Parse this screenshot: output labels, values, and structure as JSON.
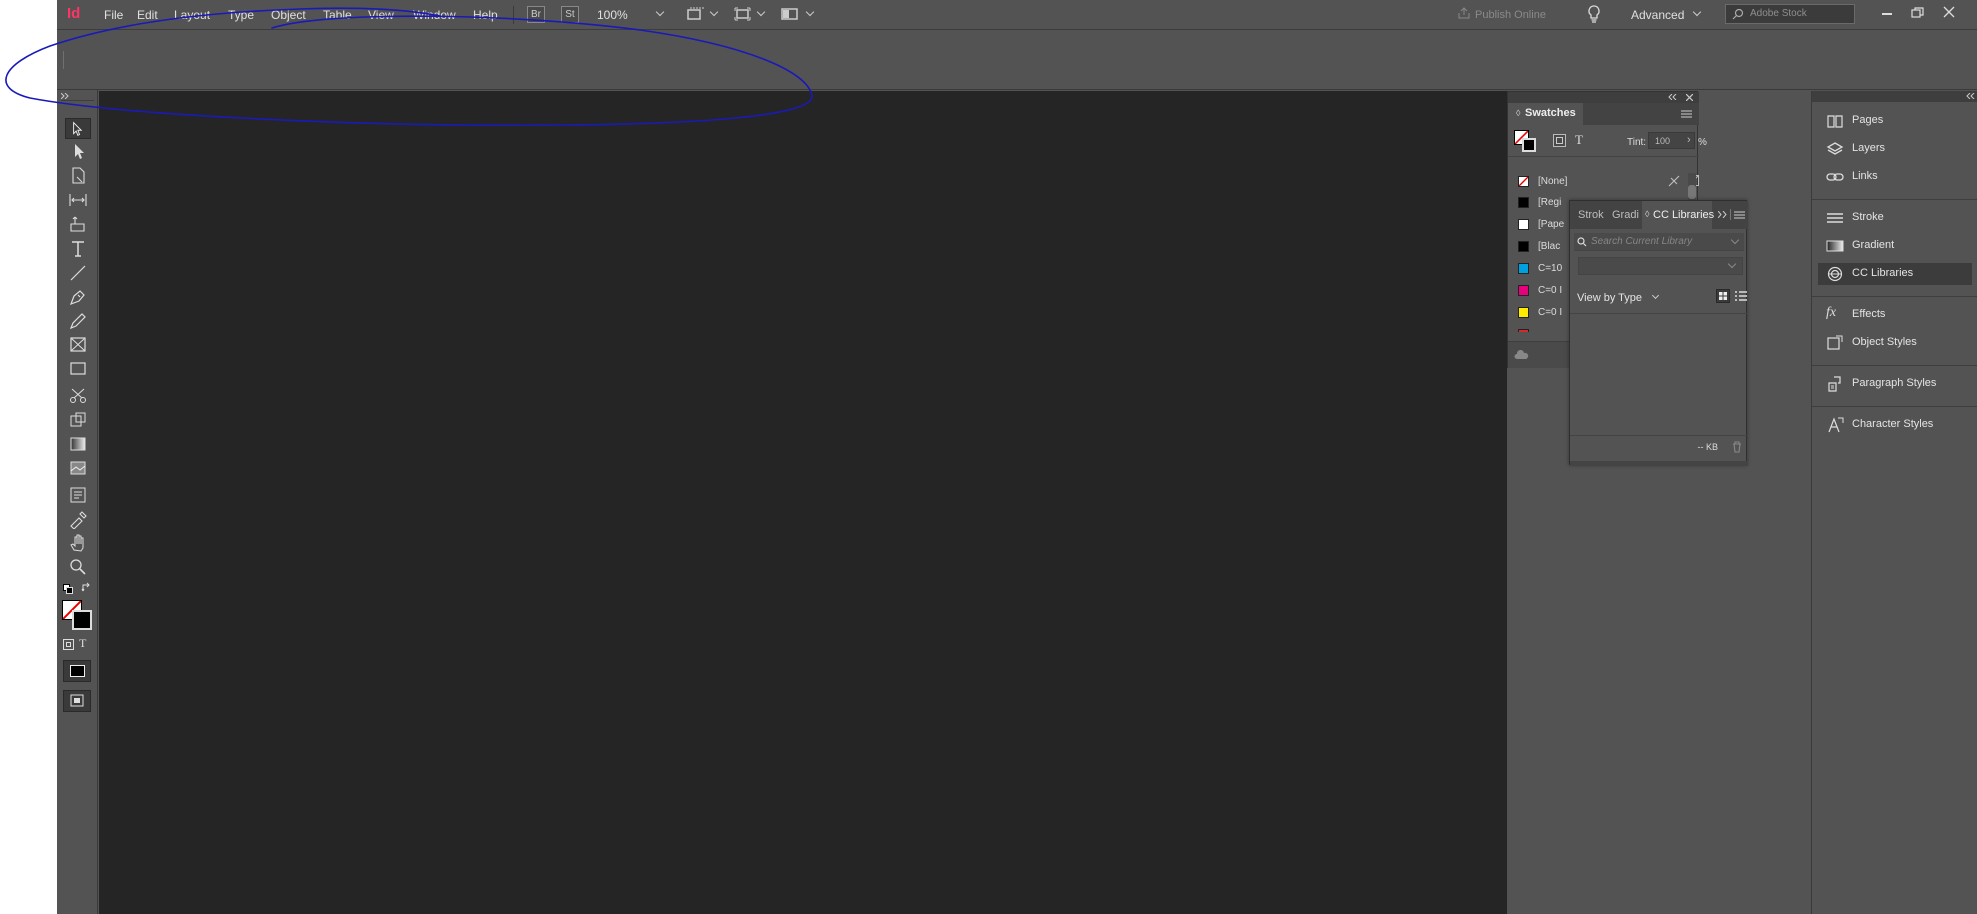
{
  "app": {
    "logo": "Id",
    "menu": [
      "File",
      "Edit",
      "Layout",
      "Type",
      "Object",
      "Table",
      "View",
      "Window",
      "Help"
    ],
    "bridge": "Br",
    "stock_btn": "St",
    "zoom": "100%",
    "publish": "Publish Online",
    "workspace": "Advanced",
    "search_placeholder": "Adobe Stock"
  },
  "swatches": {
    "title": "Swatches",
    "tint_label": "Tint:",
    "tint_value": "100",
    "tint_unit": "%",
    "items": [
      {
        "name": "[None]",
        "color": "#ffffff"
      },
      {
        "name": "[Regi",
        "color": "#000000"
      },
      {
        "name": "[Pape",
        "color": "#ffffff"
      },
      {
        "name": "[Blac",
        "color": "#000000"
      },
      {
        "name": "C=10",
        "color": "#00a0e0"
      },
      {
        "name": "C=0 I",
        "color": "#e6007e"
      },
      {
        "name": "C=0 I",
        "color": "#ffec00"
      }
    ]
  },
  "cc_libraries": {
    "tabs": [
      "Strok",
      "Gradi",
      "CC Libraries"
    ],
    "search_placeholder": "Search Current Library",
    "view_by": "View by Type",
    "size": "-- KB"
  },
  "dock": {
    "items": [
      {
        "label": "Pages",
        "icon": "pages-icon"
      },
      {
        "label": "Layers",
        "icon": "layers-icon"
      },
      {
        "label": "Links",
        "icon": "links-icon"
      },
      {
        "label": "Stroke",
        "icon": "stroke-icon"
      },
      {
        "label": "Gradient",
        "icon": "gradient-icon"
      },
      {
        "label": "CC Libraries",
        "icon": "cc-libraries-icon"
      },
      {
        "label": "Effects",
        "icon": "effects-icon"
      },
      {
        "label": "Object Styles",
        "icon": "object-styles-icon"
      },
      {
        "label": "Paragraph Styles",
        "icon": "paragraph-styles-icon"
      },
      {
        "label": "Character Styles",
        "icon": "character-styles-icon"
      }
    ]
  },
  "colors": {
    "ui": "#535353",
    "pasteboard": "#252525",
    "annotation": "#1a1ab8",
    "logo": "#ff3366"
  }
}
